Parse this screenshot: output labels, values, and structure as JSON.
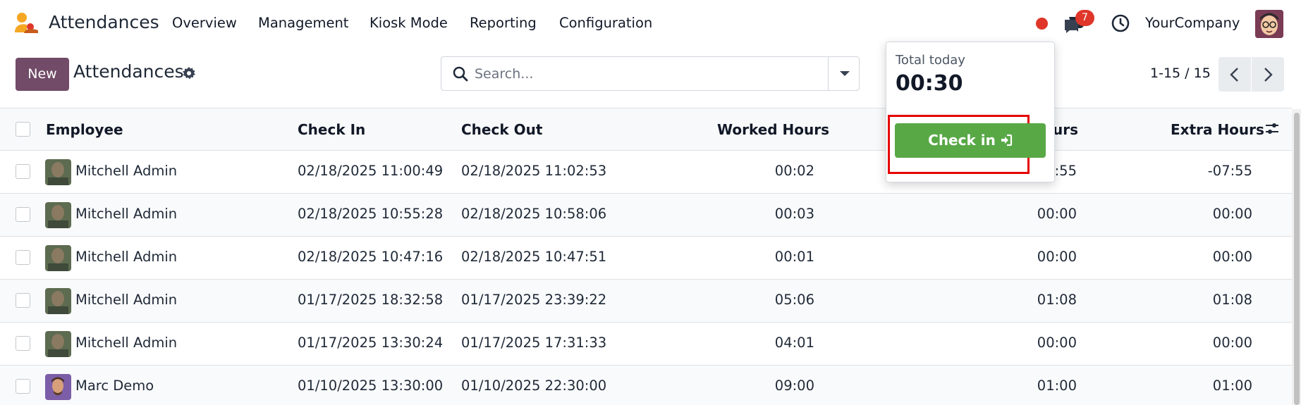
{
  "navbar": {
    "app_name": "Attendances",
    "menu": [
      "Overview",
      "Management",
      "Kiosk Mode",
      "Reporting",
      "Configuration"
    ],
    "chat_badge": "7",
    "company": "YourCompany"
  },
  "control_panel": {
    "new_label": "New",
    "title": "Attendances",
    "search_placeholder": "Search...",
    "pager": "1-15 / 15"
  },
  "table": {
    "columns": [
      "Employee",
      "Check In",
      "Check Out",
      "Worked Hours",
      "urs",
      "Extra Hours"
    ],
    "rows": [
      {
        "employee": "Mitchell Admin",
        "check_in": "02/18/2025 11:00:49",
        "check_out": "02/18/2025 11:02:53",
        "worked": "00:02",
        "overtime": "7:55",
        "extra": "-07:55"
      },
      {
        "employee": "Mitchell Admin",
        "check_in": "02/18/2025 10:55:28",
        "check_out": "02/18/2025 10:58:06",
        "worked": "00:03",
        "overtime": "00:00",
        "extra": "00:00"
      },
      {
        "employee": "Mitchell Admin",
        "check_in": "02/18/2025 10:47:16",
        "check_out": "02/18/2025 10:47:51",
        "worked": "00:01",
        "overtime": "00:00",
        "extra": "00:00"
      },
      {
        "employee": "Mitchell Admin",
        "check_in": "01/17/2025 18:32:58",
        "check_out": "01/17/2025 23:39:22",
        "worked": "05:06",
        "overtime": "01:08",
        "extra": "01:08"
      },
      {
        "employee": "Mitchell Admin",
        "check_in": "01/17/2025 13:30:24",
        "check_out": "01/17/2025 17:31:33",
        "worked": "04:01",
        "overtime": "00:00",
        "extra": "00:00"
      },
      {
        "employee": "Marc Demo",
        "check_in": "01/10/2025 13:30:00",
        "check_out": "01/10/2025 22:30:00",
        "worked": "09:00",
        "overtime": "01:00",
        "extra": "01:00"
      }
    ]
  },
  "popover": {
    "total_label": "Total today",
    "total_value": "00:30",
    "checkin_label": "Check in"
  },
  "colors": {
    "brand": "#714b67",
    "checkin_green": "#58a846",
    "badge_red": "#e0362a",
    "highlight_red": "#e60000"
  },
  "icons": [
    "app-logo-icon",
    "chat-icon",
    "clock-icon",
    "gear-icon",
    "search-icon",
    "chevron-left-icon",
    "chevron-right-icon",
    "column-settings-icon",
    "sign-in-icon"
  ]
}
